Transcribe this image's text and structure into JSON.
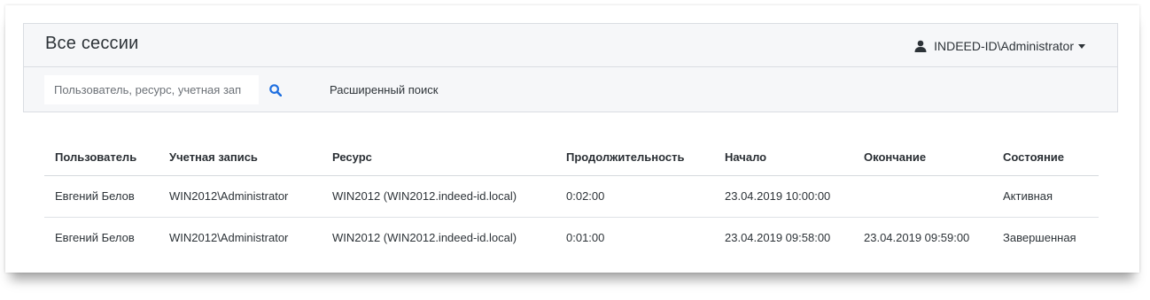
{
  "header": {
    "title": "Все сессии",
    "user": "INDEED-ID\\Administrator",
    "user_icon": "user-icon",
    "caret_icon": "chevron-down-icon"
  },
  "toolbar": {
    "search_placeholder": "Пользователь, ресурс, учетная зап",
    "search_value": "",
    "search_icon": "search-icon",
    "search_icon_color": "#1f6fe0",
    "advanced_search_label": "Расширенный поиск"
  },
  "table": {
    "columns": [
      "Пользователь",
      "Учетная запись",
      "Ресурс",
      "Продолжительность",
      "Начало",
      "Окончание",
      "Состояние"
    ],
    "rows": [
      [
        "Евгений Белов",
        "WIN2012\\Administrator",
        "WIN2012 (WIN2012.indeed-id.local)",
        "0:02:00",
        "23.04.2019 10:00:00",
        "",
        "Активная"
      ],
      [
        "Евгений Белов",
        "WIN2012\\Administrator",
        "WIN2012 (WIN2012.indeed-id.local)",
        "0:01:00",
        "23.04.2019 09:58:00",
        "23.04.2019 09:59:00",
        "Завершенная"
      ]
    ]
  }
}
